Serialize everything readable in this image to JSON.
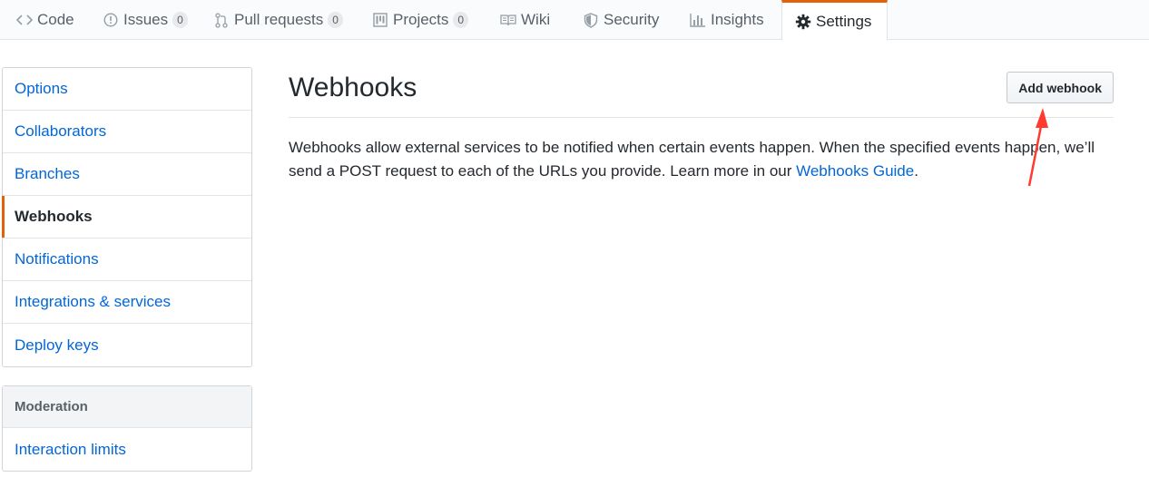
{
  "nav": {
    "tabs": [
      {
        "label": "Code",
        "icon": "code-icon"
      },
      {
        "label": "Issues",
        "icon": "issue-opened-icon",
        "count": "0"
      },
      {
        "label": "Pull requests",
        "icon": "git-pull-request-icon",
        "count": "0"
      },
      {
        "label": "Projects",
        "icon": "project-icon",
        "count": "0"
      },
      {
        "label": "Wiki",
        "icon": "book-icon"
      },
      {
        "label": "Security",
        "icon": "shield-icon"
      },
      {
        "label": "Insights",
        "icon": "graph-icon"
      },
      {
        "label": "Settings",
        "icon": "gear-icon",
        "selected": true
      }
    ]
  },
  "sidebar": {
    "items": [
      {
        "label": "Options"
      },
      {
        "label": "Collaborators"
      },
      {
        "label": "Branches"
      },
      {
        "label": "Webhooks",
        "selected": true
      },
      {
        "label": "Notifications"
      },
      {
        "label": "Integrations & services"
      },
      {
        "label": "Deploy keys"
      }
    ],
    "moderation": {
      "heading": "Moderation",
      "items": [
        {
          "label": "Interaction limits"
        }
      ]
    }
  },
  "main": {
    "title": "Webhooks",
    "add_button": "Add webhook",
    "description_text": "Webhooks allow external services to be notified when certain events happen. When the specified events happen, we’ll send a POST request to each of the URLs you provide. Learn more in our ",
    "link_text": "Webhooks Guide",
    "description_end": "."
  },
  "colors": {
    "link": "#0366d6",
    "selected_accent": "#e36209",
    "annotation_arrow": "#ff3b30"
  }
}
